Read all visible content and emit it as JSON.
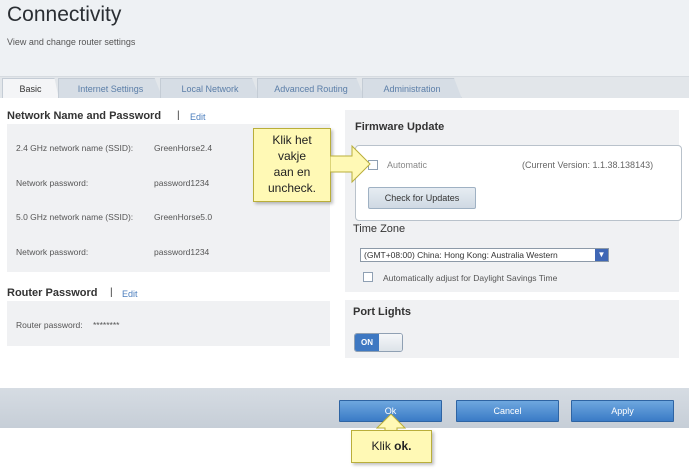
{
  "header": {
    "title": "Connectivity",
    "subtitle": "View and change router settings"
  },
  "tabs": [
    {
      "label": "Basic"
    },
    {
      "label": "Internet Settings"
    },
    {
      "label": "Local Network"
    },
    {
      "label": "Advanced Routing"
    },
    {
      "label": "Administration"
    }
  ],
  "network": {
    "title": "Network Name and Password",
    "separator": "|",
    "edit_label": "Edit",
    "rows": [
      {
        "label": "2.4 GHz network name (SSID):",
        "value": "GreenHorse2.4"
      },
      {
        "label": "Network password:",
        "value": "password1234"
      },
      {
        "label": "5.0 GHz network name (SSID):",
        "value": "GreenHorse5.0"
      },
      {
        "label": "Network password:",
        "value": "password1234"
      }
    ]
  },
  "router_password": {
    "title": "Router Password",
    "separator": "|",
    "edit_label": "Edit",
    "label": "Router password:",
    "value": "********"
  },
  "firmware": {
    "title": "Firmware Update",
    "automatic_label": "Automatic",
    "current_version": "(Current Version: 1.1.38.138143)",
    "check_button": "Check for Updates"
  },
  "time_zone": {
    "title": "Time Zone",
    "selected": "(GMT+08:00) China: Hong Kong: Australia Western",
    "dst_label": "Automatically adjust for Daylight Savings Time"
  },
  "port_lights": {
    "title": "Port Lights",
    "toggle_label": "ON"
  },
  "footer": {
    "ok": "Ok",
    "cancel": "Cancel",
    "apply": "Apply"
  },
  "callouts": {
    "checkbox_lines": [
      "Klik het",
      "vakje",
      "aan en",
      "uncheck."
    ],
    "ok_prefix": "Klik",
    "ok_bold": "ok."
  },
  "colors": {
    "accent": "#3a7bc6",
    "link": "#4a7dbd",
    "callout_bg": "#fff9b5"
  }
}
